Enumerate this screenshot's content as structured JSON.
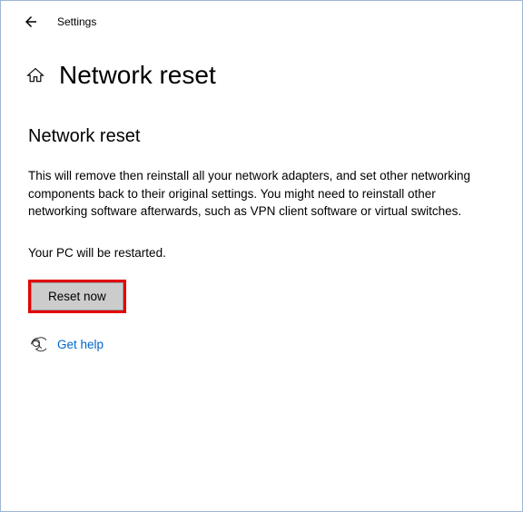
{
  "header": {
    "app_label": "Settings"
  },
  "title": "Network reset",
  "section": {
    "heading": "Network reset",
    "description": "This will remove then reinstall all your network adapters, and set other networking components back to their original settings. You might need to reinstall other networking software afterwards, such as VPN client software or virtual switches.",
    "restart_note": "Your PC will be restarted."
  },
  "buttons": {
    "reset_now": "Reset now"
  },
  "help": {
    "label": "Get help"
  },
  "colors": {
    "highlight_border": "#e30000",
    "link": "#0066cc",
    "window_border": "#9fb5d4",
    "button_bg": "#cccccc"
  }
}
